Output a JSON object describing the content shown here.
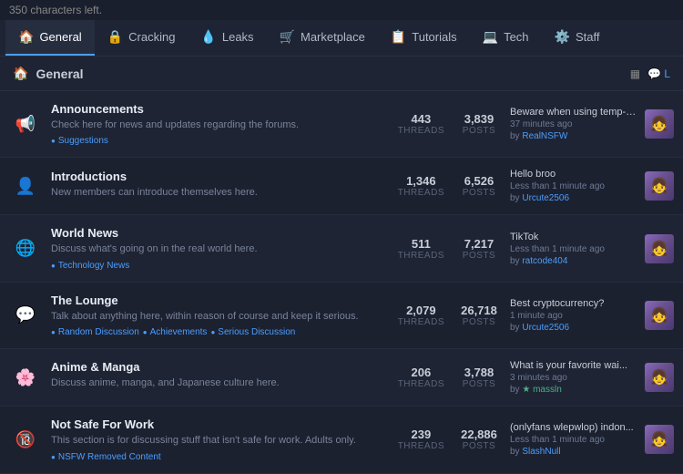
{
  "chars_left": "350 characters left.",
  "nav": {
    "tabs": [
      {
        "label": "General",
        "icon": "🏠",
        "active": true
      },
      {
        "label": "Cracking",
        "icon": "🔒",
        "active": false
      },
      {
        "label": "Leaks",
        "icon": "💧",
        "active": false
      },
      {
        "label": "Marketplace",
        "icon": "🛒",
        "active": false
      },
      {
        "label": "Tutorials",
        "icon": "📋",
        "active": false
      },
      {
        "label": "Tech",
        "icon": "💻",
        "active": false
      },
      {
        "label": "Staff",
        "icon": "⚙️",
        "active": false
      }
    ]
  },
  "section": {
    "title": "General",
    "icon": "🏠"
  },
  "forums": [
    {
      "icon": "📢",
      "title": "Announcements",
      "desc": "Check here for news and updates regarding the forums.",
      "tags": [
        "Suggestions"
      ],
      "threads": "443",
      "posts": "3,839",
      "latest_title": "Beware when using temp-ma...",
      "latest_time": "37 minutes ago",
      "latest_by": "RealNSFW",
      "latest_by_color": "blue"
    },
    {
      "icon": "👤",
      "title": "Introductions",
      "desc": "New members can introduce themselves here.",
      "tags": [],
      "threads": "1,346",
      "posts": "6,526",
      "latest_title": "Hello broo",
      "latest_time": "Less than 1 minute ago",
      "latest_by": "Urcute2506",
      "latest_by_color": "blue"
    },
    {
      "icon": "🌐",
      "title": "World News",
      "desc": "Discuss what's going on in the real world here.",
      "tags": [
        "Technology News"
      ],
      "threads": "511",
      "posts": "7,217",
      "latest_title": "TikTok",
      "latest_time": "Less than 1 minute ago",
      "latest_by": "ratcode404",
      "latest_by_color": "blue"
    },
    {
      "icon": "💬",
      "title": "The Lounge",
      "desc": "Talk about anything here, within reason of course and keep it serious.",
      "tags": [
        "Random Discussion",
        "Achievements",
        "Serious Discussion"
      ],
      "threads": "2,079",
      "posts": "26,718",
      "latest_title": "Best cryptocurrency?",
      "latest_time": "1 minute ago",
      "latest_by": "Urcute2506",
      "latest_by_color": "blue"
    },
    {
      "icon": "🌸",
      "title": "Anime & Manga",
      "desc": "Discuss anime, manga, and Japanese culture here.",
      "tags": [],
      "threads": "206",
      "posts": "3,788",
      "latest_title": "What is your favorite wai...",
      "latest_time": "3 minutes ago",
      "latest_by": "★ massln",
      "latest_by_color": "green"
    },
    {
      "icon": "🔞",
      "title": "Not Safe For Work",
      "desc": "This section is for discussing stuff that isn't safe for work. Adults only.",
      "tags": [
        "NSFW Removed Content"
      ],
      "threads": "239",
      "posts": "22,886",
      "latest_title": "(onlyfans wlepwlop) indon...",
      "latest_time": "Less than 1 minute ago",
      "latest_by": "SlashNull",
      "latest_by_color": "blue"
    }
  ]
}
